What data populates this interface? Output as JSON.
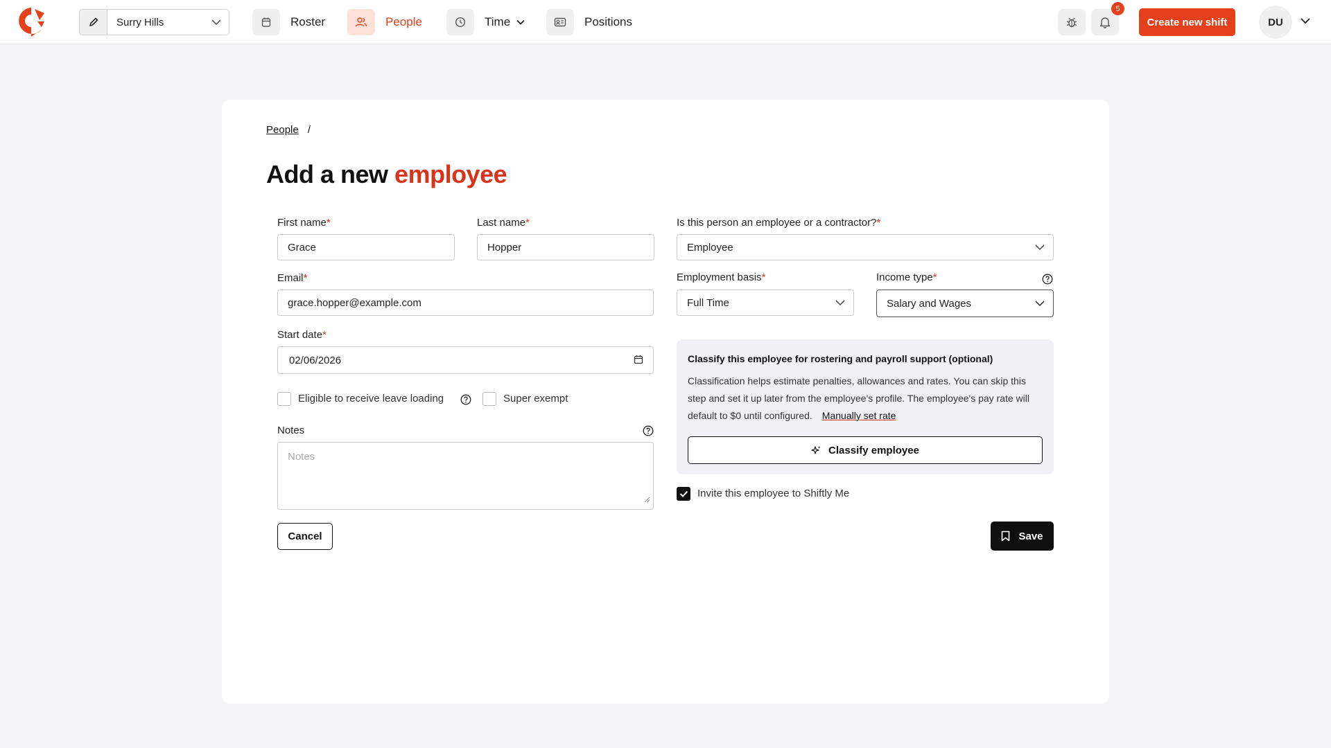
{
  "nav": {
    "location": "Surry Hills",
    "items": [
      {
        "label": "Roster",
        "icon": "calendar-icon"
      },
      {
        "label": "People",
        "icon": "people-icon"
      },
      {
        "label": "Time",
        "icon": "clock-icon"
      },
      {
        "label": "Positions",
        "icon": "id-card-icon"
      }
    ],
    "notification_count": "5",
    "create_shift_label": "Create new shift",
    "avatar_initials": "DU",
    "accent_color": "#e5401a"
  },
  "breadcrumb": {
    "parent": "People",
    "separator": "/"
  },
  "title": {
    "prefix": "Add a new",
    "accent": "employee"
  },
  "form": {
    "first_name": {
      "label": "First name",
      "value": "Grace"
    },
    "last_name": {
      "label": "Last name",
      "value": "Hopper"
    },
    "email": {
      "label": "Email",
      "value": "grace.hopper@example.com"
    },
    "start_date": {
      "label": "Start date",
      "value": "02/06/2026"
    },
    "leave_loading_label": "Eligible to receive leave loading",
    "super_exempt_label": "Super exempt",
    "notes": {
      "label": "Notes",
      "placeholder": "Notes"
    },
    "person_type": {
      "label": "Is this person an employee or a contractor?",
      "value": "Employee"
    },
    "employment_basis": {
      "label": "Employment basis",
      "value": "Full Time"
    },
    "income_type": {
      "label": "Income type",
      "value": "Salary and Wages"
    },
    "required_marker": "*"
  },
  "classify": {
    "title": "Classify this employee for rostering and payroll support (optional)",
    "text": "Classification helps estimate penalties, allowances and rates. You can skip this step and set it up later from the employee's profile. The employee's pay rate will default to $0 until configured.",
    "link": "Manually set rate",
    "button": "Classify employee"
  },
  "invite_label": "Invite this employee to Shiftly Me",
  "invite_checked": true,
  "actions": {
    "cancel": "Cancel",
    "save": "Save"
  }
}
